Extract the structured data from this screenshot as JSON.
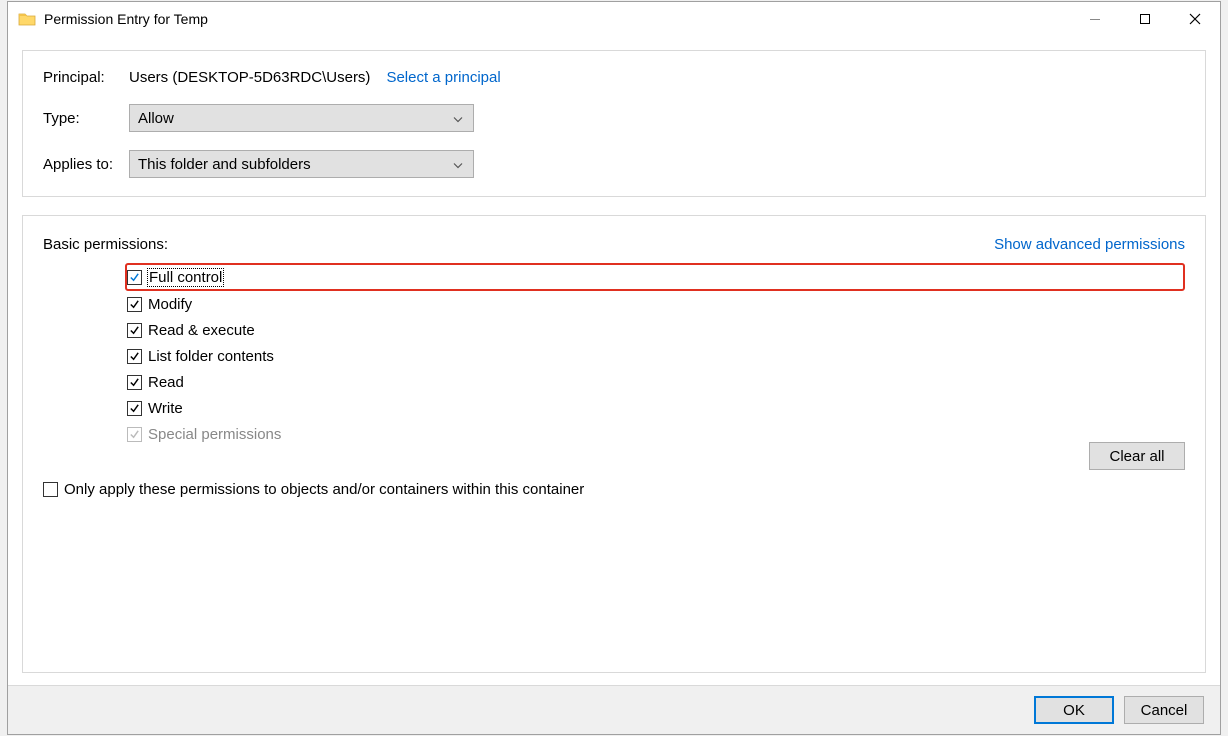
{
  "window": {
    "title": "Permission Entry for Temp"
  },
  "principal": {
    "label": "Principal:",
    "value": "Users (DESKTOP-5D63RDC\\Users)",
    "select_link": "Select a principal"
  },
  "type": {
    "label": "Type:",
    "value": "Allow"
  },
  "applies_to": {
    "label": "Applies to:",
    "value": "This folder and subfolders"
  },
  "permissions": {
    "heading": "Basic permissions:",
    "advanced_link": "Show advanced permissions",
    "items": [
      {
        "label": "Full control",
        "checked": true,
        "disabled": false,
        "highlighted": true,
        "focused": true,
        "check_color": "#0078d7"
      },
      {
        "label": "Modify",
        "checked": true,
        "disabled": false,
        "highlighted": false,
        "focused": false,
        "check_color": "#000"
      },
      {
        "label": "Read & execute",
        "checked": true,
        "disabled": false,
        "highlighted": false,
        "focused": false,
        "check_color": "#000"
      },
      {
        "label": "List folder contents",
        "checked": true,
        "disabled": false,
        "highlighted": false,
        "focused": false,
        "check_color": "#000"
      },
      {
        "label": "Read",
        "checked": true,
        "disabled": false,
        "highlighted": false,
        "focused": false,
        "check_color": "#000"
      },
      {
        "label": "Write",
        "checked": true,
        "disabled": false,
        "highlighted": false,
        "focused": false,
        "check_color": "#000"
      },
      {
        "label": "Special permissions",
        "checked": true,
        "disabled": true,
        "highlighted": false,
        "focused": false,
        "check_color": "#bbb"
      }
    ]
  },
  "only_apply": {
    "label": "Only apply these permissions to objects and/or containers within this container",
    "checked": false
  },
  "buttons": {
    "clear_all": "Clear all",
    "ok": "OK",
    "cancel": "Cancel"
  }
}
